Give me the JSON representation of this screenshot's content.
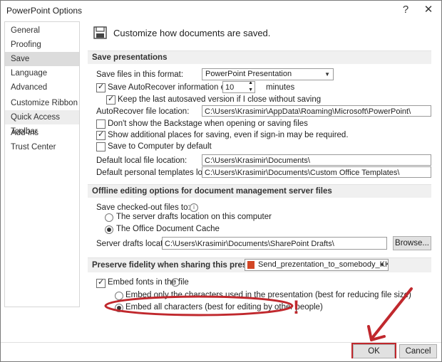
{
  "window": {
    "title": "PowerPoint Options",
    "help_glyph": "?",
    "close_glyph": "✕"
  },
  "sidebar": {
    "items": [
      {
        "label": "General"
      },
      {
        "label": "Proofing"
      },
      {
        "label": "Save"
      },
      {
        "label": "Language"
      },
      {
        "label": "Advanced"
      },
      {
        "label": "Customize Ribbon"
      },
      {
        "label": "Quick Access Toolbar"
      },
      {
        "label": "Add-ins"
      },
      {
        "label": "Trust Center"
      }
    ]
  },
  "header": {
    "text": "Customize how documents are saved."
  },
  "save_presentations": {
    "heading": "Save presentations",
    "format_label": "Save files in this format:",
    "format_value": "PowerPoint Presentation",
    "autorecover_label": "Save AutoRecover information every",
    "autorecover_minutes": "10",
    "minutes_label": "minutes",
    "keep_last_label": "Keep the last autosaved version if I close without saving",
    "autorecover_location_label": "AutoRecover file location:",
    "autorecover_location_value": "C:\\Users\\Krasimir\\AppData\\Roaming\\Microsoft\\PowerPoint\\",
    "no_backstage_label": "Don't show the Backstage when opening or saving files",
    "show_places_label": "Show additional places for saving, even if sign-in may be required.",
    "save_to_computer_label": "Save to Computer by default",
    "default_local_label": "Default local file location:",
    "default_local_value": "C:\\Users\\Krasimir\\Documents\\",
    "default_templates_label": "Default personal templates location:",
    "default_templates_value": "C:\\Users\\Krasimir\\Documents\\Custom Office Templates\\"
  },
  "offline": {
    "heading": "Offline editing options for document management server files",
    "save_checked_out_label": "Save checked-out files to:",
    "server_drafts_option": "The server drafts location on this computer",
    "office_cache_option": "The Office Document Cache",
    "server_drafts_label": "Server drafts location:",
    "server_drafts_value": "C:\\Users\\Krasimir\\Documents\\SharePoint Drafts\\",
    "browse_label": "Browse..."
  },
  "fidelity": {
    "heading": "Preserve fidelity when sharing this presentation:",
    "file_value": "Send_prezentation_to_somebody_KK.pptx",
    "embed_fonts_label": "Embed fonts in the file",
    "embed_only_used": "Embed only the characters used in the presentation (best for reducing file size)",
    "embed_all": "Embed all characters (best for editing by other people)",
    "exclamation": "!"
  },
  "footer": {
    "ok_label": "OK",
    "cancel_label": "Cancel"
  },
  "colors": {
    "annotation_red": "#c0282d"
  }
}
